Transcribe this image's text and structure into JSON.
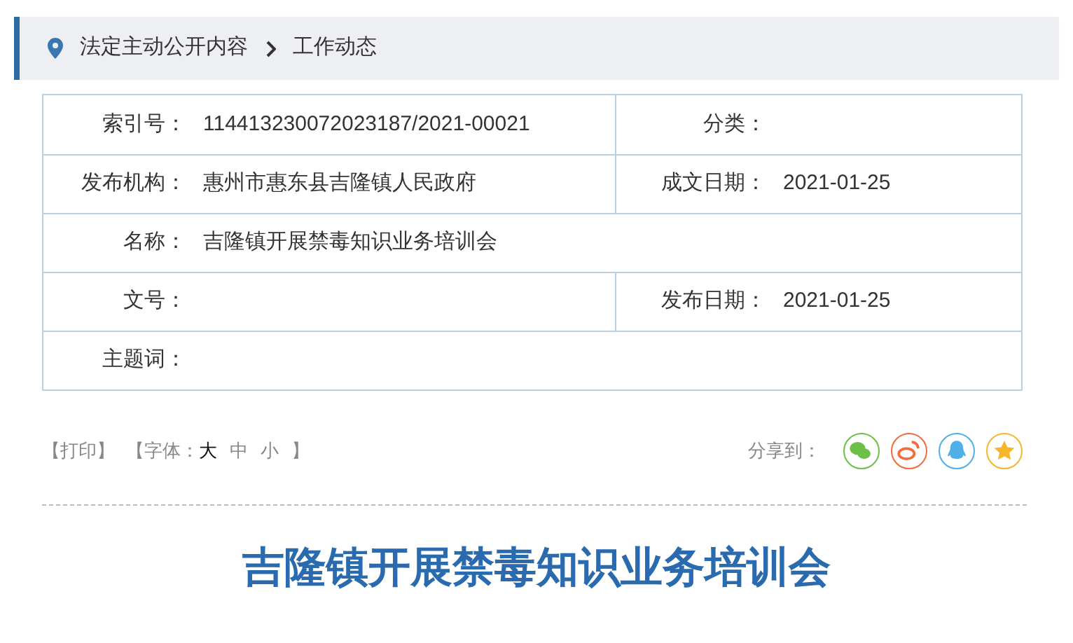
{
  "breadcrumb": [
    "法定主动公开内容",
    "工作动态"
  ],
  "info_table": {
    "rows": [
      [
        {
          "label": "索引号：",
          "value": "114413230072023187/2021-00021"
        },
        {
          "label": "分类："
        }
      ],
      [
        {
          "label": "发布机构：",
          "value": "惠州市惠东县吉隆镇人民政府"
        },
        {
          "label": "成文日期：",
          "value": "2021-01-25"
        }
      ],
      [
        {
          "label": "名称：",
          "value": "吉隆镇开展禁毒知识业务培训会"
        }
      ],
      [
        {
          "label": "文号："
        },
        {
          "label": "发布日期：",
          "value": "2021-01-25"
        }
      ],
      [
        {
          "label": "主题词："
        }
      ]
    ]
  },
  "tools": {
    "print": "【打印】",
    "font_open": "【字体：",
    "font_sizes": [
      {
        "label": "大",
        "selected": true
      },
      {
        "label": "中",
        "selected": false
      },
      {
        "label": "小",
        "selected": false
      }
    ],
    "font_close": "】"
  },
  "share": {
    "label": "分享到：",
    "targets": [
      {
        "kind": "wechat",
        "color": "#6cc04a"
      },
      {
        "kind": "weibo",
        "color": "#f26b3a"
      },
      {
        "kind": "qq",
        "color": "#4fb0e8"
      },
      {
        "kind": "favorite",
        "color": "#f7b52c"
      }
    ]
  },
  "article_title": "吉隆镇开展禁毒知识业务培训会"
}
